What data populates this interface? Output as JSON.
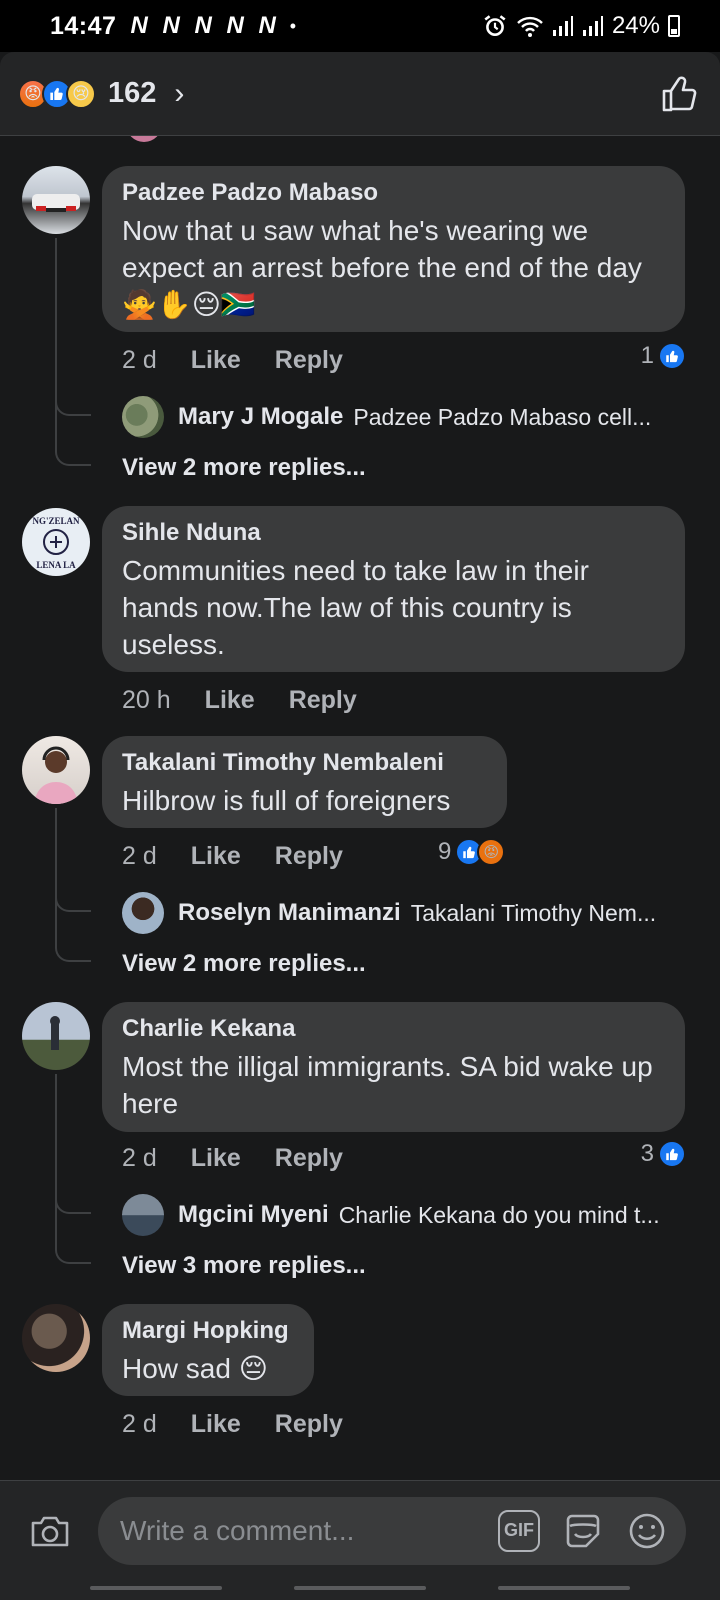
{
  "status_bar": {
    "time": "14:47",
    "notifications": "N N N N N",
    "dot": "•",
    "battery": "24%"
  },
  "header": {
    "reaction_icons": [
      "angry-icon",
      "like-icon",
      "sad-icon"
    ],
    "reaction_count": "162",
    "chevron": "›"
  },
  "comments": [
    {
      "author": "Padzee Padzo Mabaso",
      "text": "Now that u saw what he's wearing we expect an arrest before the end of the day 🙅✋😔🇿🇦",
      "time": "2 d",
      "like_label": "Like",
      "reply_label": "Reply",
      "reaction_count": "1",
      "reply_preview": {
        "author": "Mary J Mogale",
        "snippet": "Padzee Padzo Mabaso cell..."
      },
      "more_replies": "View 2 more replies..."
    },
    {
      "author": "Sihle Nduna",
      "text": "Communities need to take law in their hands now.The law of this country is useless.",
      "time": "20 h",
      "like_label": "Like",
      "reply_label": "Reply"
    },
    {
      "author": "Takalani Timothy Nembaleni",
      "text": "Hilbrow is full of foreigners",
      "time": "2 d",
      "like_label": "Like",
      "reply_label": "Reply",
      "reaction_count": "9",
      "reply_preview": {
        "author": "Roselyn Manimanzi",
        "snippet": "Takalani Timothy Nem..."
      },
      "more_replies": "View 2 more replies..."
    },
    {
      "author": "Charlie Kekana",
      "text": "Most the illigal immigrants. SA bid wake up here",
      "time": "2 d",
      "like_label": "Like",
      "reply_label": "Reply",
      "reaction_count": "3",
      "reply_preview": {
        "author": "Mgcini Myeni",
        "snippet": "Charlie Kekana do you mind t..."
      },
      "more_replies": "View 3 more replies..."
    },
    {
      "author": "Margi Hopking",
      "text": "How sad 😔",
      "time": "2 d",
      "like_label": "Like",
      "reply_label": "Reply"
    }
  ],
  "composer": {
    "placeholder": "Write a comment...",
    "gif_label": "GIF"
  },
  "colors": {
    "background": "#18191a",
    "bubble": "#3a3b3c",
    "like_blue": "#1877f2",
    "angry_orange": "#e9710f"
  }
}
